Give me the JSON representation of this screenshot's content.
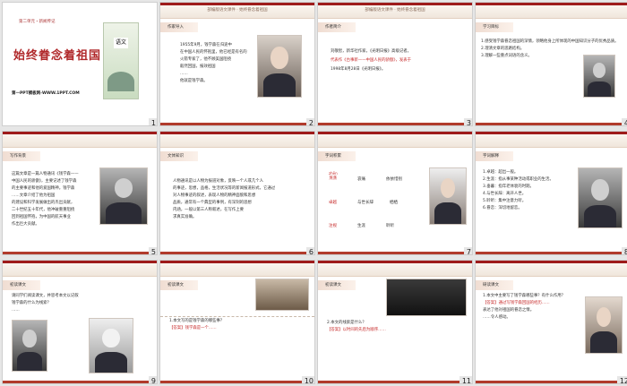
{
  "slides": [
    {
      "num": "1",
      "title": "始终眷念着祖国",
      "unit": "第二单元・新闻传记",
      "book": "语文",
      "site": "第一PPT模板网-WWW.1PPT.COM"
    },
    {
      "num": "2",
      "header": "部编版语文课件 · 始终眷念着祖国",
      "tag": "作家导入",
      "lines": [
        "1955年9月，钱学森在归途中",
        "在中国人民的怀抱里，他已经是有名的",
        "火箭专家了，他不顾美国阻挠",
        "毅然回国，报效祖国",
        "……",
        "他就是钱学森。"
      ]
    },
    {
      "num": "3",
      "header": "部编版语文课件 · 始终眷念着祖国",
      "tag": "作者简介",
      "lines": [
        "刘敬智，新华社作家，《光明日报》高级记者。",
        "代表作《古事新——中国人民的骄傲》，发表于",
        "1998年8月28日《光明日报》。"
      ],
      "redpart": "《古事新——中国人民的骄傲》"
    },
    {
      "num": "4",
      "tag": "学习目标",
      "lines": [
        "1.感受钱学森眷恋祖国的深情，领略他身上所体现的中国知识分子的优秀品质。",
        "2.理清文章的思路结构。",
        "3.理解一些重点词语的含义。"
      ]
    },
    {
      "num": "5",
      "tag": "写作背景",
      "lines": [
        "这篇文章是一篇人物通讯《钱学森——",
        "中国人民的骄傲》，主要记述了钱学森",
        "的主要事迹和他的爱国精神。钱学森",
        "……文章介绍了他为祖国",
        "的建设和科学发展做出的杰出贡献，",
        "二十世纪五十年代，他冲破重重阻挠",
        "回到祖国怀抱，为中国的航天事业",
        "作出巨大贡献。"
      ]
    },
    {
      "num": "6",
      "tag": "文体知识",
      "lines": [
        "人物通讯是以人物为报道对象，反映一个人或几个人",
        "的事迹，思想，品格，生活状况等的新闻报道形式，它通过",
        "对人物事迹的叙述，表现人物的精神面貌和思想",
        "品质，通常有一个典型的事例，有深刻的思想",
        "内涵，一般以第三人称叙述，在写作上要",
        "求真实准确。"
      ]
    },
    {
      "num": "7",
      "tag": "字词积累",
      "words": [
        {
          "py": "zhēn",
          "w": "蒸蒸"
        },
        {
          "py": "",
          "w": "哀痛"
        },
        {
          "py": "",
          "w": "依依惜别"
        },
        {
          "py": "",
          "w": "卓越"
        },
        {
          "py": "",
          "w": "与世长辞"
        },
        {
          "py": "",
          "w": "栖栖"
        },
        {
          "py": "",
          "w": "注视"
        },
        {
          "py": "",
          "w": "生涯"
        },
        {
          "py": "",
          "w": "聆听"
        }
      ]
    },
    {
      "num": "8",
      "tag": "字词解释",
      "lines": [
        "1.卓越：超出一般。",
        "2.生涯：指从事某种活动或职业的生活。",
        "3.垂暮：指年老体衰的时期。",
        "4.与世长辞：离开人世。",
        "5.聆听：集中注意力听。",
        "6.眷恋：深切地留恋。"
      ]
    },
    {
      "num": "9",
      "tag": "初读课文",
      "lines": [
        "请同学们阅读课文，并思考本文以记叙",
        "钱学森的什么为线索？",
        "……"
      ]
    },
    {
      "num": "10",
      "tag": "初读课文",
      "lines": [
        "1.本文写的是钱学森的哪些事？",
        "【答案】钱学森是一个……"
      ]
    },
    {
      "num": "11",
      "tag": "初读课文",
      "lines": [
        "2.本文的线索是什么？",
        "【答案】以时间的先后为顺序……"
      ]
    },
    {
      "num": "12",
      "tag": "研读课文",
      "lines": [
        "1.本文中主要写了钱学森哪些事？有什么作用？",
        "【答案】通过写钱学森回国的经历……",
        "表达了他对祖国的眷恋之情。",
        "……令人感动。"
      ]
    }
  ],
  "accent": "#9e1b1b"
}
